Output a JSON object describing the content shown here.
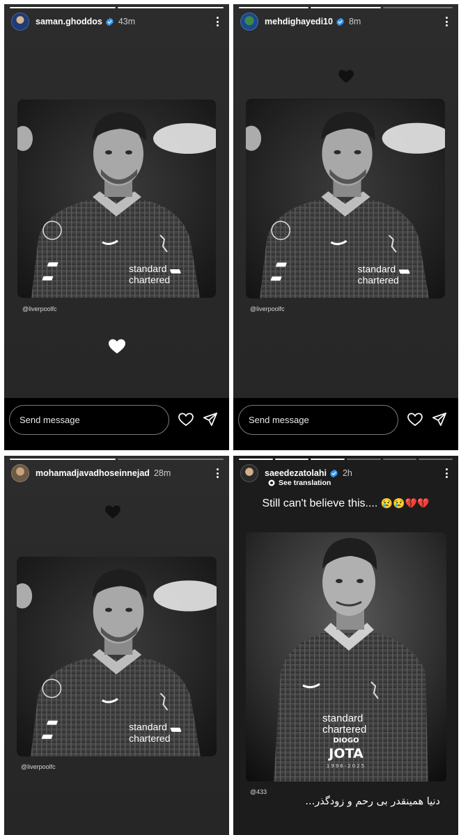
{
  "stories": [
    {
      "username": "saman.ghoddos",
      "time": "43m",
      "credit": "@liverpoolfc",
      "photo_sponsor": [
        "standard",
        "chartered"
      ],
      "message_placeholder": "Send message"
    },
    {
      "username": "mehdighayedi10",
      "time": "8m",
      "credit": "@liverpoolfc",
      "photo_sponsor": [
        "standard",
        "chartered"
      ],
      "message_placeholder": "Send message"
    },
    {
      "username": "mohamadjavadhoseinnejad",
      "time": "28m",
      "credit": "@liverpoolfc",
      "photo_sponsor": [
        "standard",
        "chartered"
      ]
    },
    {
      "username": "saeedezatolahi",
      "time": "2h",
      "translate_label": "See translation",
      "caption": "Still can't believe this....",
      "caption_emoji": "😢😢💔💔",
      "photo_sponsor": [
        "standard",
        "chartered"
      ],
      "player_first": "DIOGO",
      "player_last": "JOTA",
      "player_years": "1996-2025",
      "credit": "@433",
      "rtl_caption": "دنیا همینقدر بی رحم و زودگذر..."
    }
  ],
  "colors": {
    "panel_bg": "#2b2b2b",
    "footer_bg": "#000000",
    "verified": "#3897f0",
    "heart_red": "#d62b3a"
  }
}
